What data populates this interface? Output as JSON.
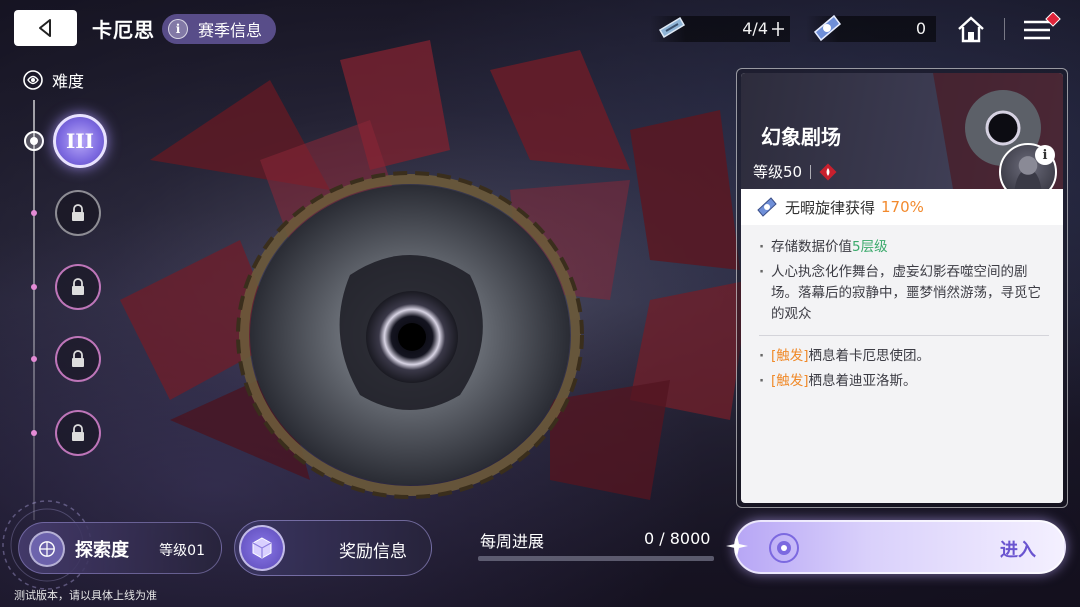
{
  "header": {
    "title": "卡厄思",
    "season_button": "赛季信息",
    "resource1": {
      "icon": "ticket-icon",
      "value": "4/4"
    },
    "resource2": {
      "icon": "melody-icon",
      "value": "0"
    }
  },
  "sidebar": {
    "difficulty_label": "难度",
    "selected_level": "III",
    "locked_count": 4
  },
  "card": {
    "title": "幻象剧场",
    "level": "等级50",
    "bonus_prefix": "无暇旋律获得",
    "bonus_pct": "170%",
    "store_prefix": "存储数据价值",
    "store_value": "5层级",
    "description": "人心执念化作舞台，虚妄幻影吞噬空间的剧场。落幕后的寂静中，噩梦悄然游荡，寻觅它的观众",
    "trigger_tag": "[触发]",
    "trigger1": "栖息着卡厄思使团。",
    "trigger2": "栖息着迪亚洛斯。"
  },
  "bottom": {
    "explore_label": "探索度",
    "explore_level": "等级01",
    "reward_label": "奖励信息",
    "weekly_label": "每周进展",
    "weekly_value": "0 / 8000",
    "weekly_progress": 0,
    "enter_label": "进入"
  },
  "footnote": "测试版本，请以具体上线为准",
  "colors": {
    "accent": "#7c69e0",
    "bonus": "#f28a2e",
    "store": "#3aa96b",
    "trigger": "#f08a2a",
    "enter_text": "#6a54d0"
  }
}
